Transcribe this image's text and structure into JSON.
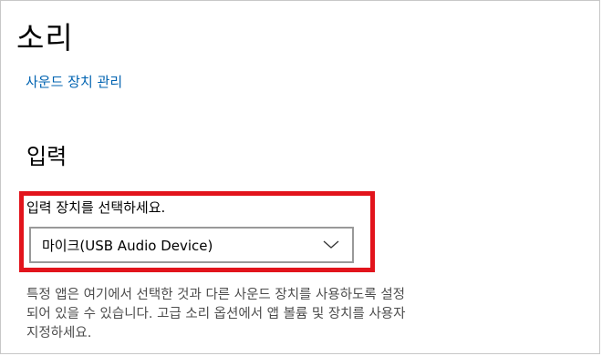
{
  "page": {
    "title": "소리",
    "manage_devices_link": "사운드 장치 관리"
  },
  "input_section": {
    "heading": "입력",
    "device_label": "입력 장치를 선택하세요.",
    "selected_device": "마이크(USB Audio Device)",
    "help_text_lines": [
      "특정 앱은 여기에서 선택한 것과 다른 사운드 장치를 사용하도록 설정",
      "되어 있을 수 있습니다. 고급 소리 옵션에서 앱 볼륨 및 장치를 사용자",
      "지정하세요."
    ]
  },
  "icons": {
    "dropdown": "chevron-down-icon"
  },
  "colors": {
    "link": "#0063b1",
    "highlight_border": "#e2141c",
    "help_text": "#4d4d4d",
    "select_border": "#999999"
  }
}
